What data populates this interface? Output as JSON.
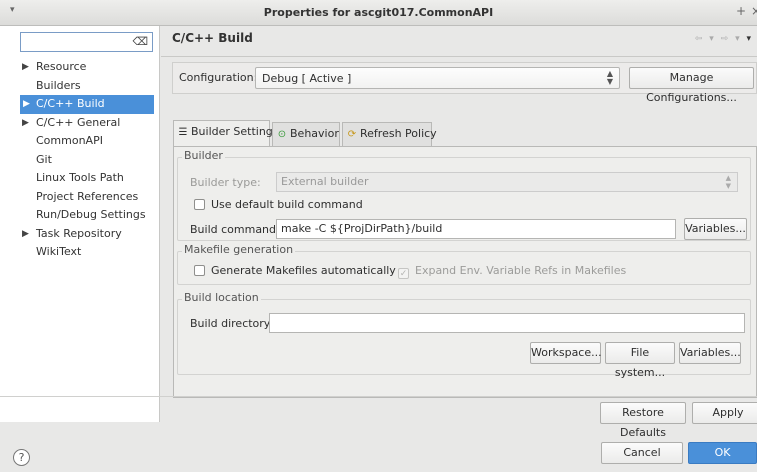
{
  "window": {
    "title": "Properties for ascgit017.CommonAPI",
    "menu_glyph": "▾",
    "btn_add": "+",
    "btn_close": "×"
  },
  "filter": {
    "value": "",
    "clear_glyph": "⌫"
  },
  "nav": {
    "items": [
      {
        "label": "Resource",
        "expandable": true,
        "twisty": "▶"
      },
      {
        "label": "Builders",
        "expandable": false,
        "twisty": ""
      },
      {
        "label": "C/C++ Build",
        "expandable": true,
        "twisty": "▶",
        "selected": true
      },
      {
        "label": "C/C++ General",
        "expandable": true,
        "twisty": "▶"
      },
      {
        "label": "CommonAPI",
        "expandable": false,
        "twisty": ""
      },
      {
        "label": "Git",
        "expandable": false,
        "twisty": ""
      },
      {
        "label": "Linux Tools Path",
        "expandable": false,
        "twisty": ""
      },
      {
        "label": "Project References",
        "expandable": false,
        "twisty": ""
      },
      {
        "label": "Run/Debug Settings",
        "expandable": false,
        "twisty": ""
      },
      {
        "label": "Task Repository",
        "expandable": true,
        "twisty": "▶"
      },
      {
        "label": "WikiText",
        "expandable": false,
        "twisty": ""
      }
    ]
  },
  "page": {
    "title": "C/C++ Build",
    "nav_back": "⇦ ▾",
    "nav_fwd": "⇨ ▾",
    "menu": "▾"
  },
  "configuration": {
    "label": "Configuration:",
    "value": "Debug  [ Active ]",
    "manage_label": "Manage Configurations..."
  },
  "tabs": [
    {
      "label": "Builder Settings",
      "icon": "☰",
      "active": true
    },
    {
      "label": "Behavior",
      "icon": "⊙",
      "active": false
    },
    {
      "label": "Refresh Policy",
      "icon": "⟳",
      "active": false
    }
  ],
  "builder": {
    "group_title": "Builder",
    "type_label": "Builder type:",
    "type_value": "External builder",
    "use_default_label": "Use default build command",
    "command_label": "Build command:",
    "command_value": "make -C ${ProjDirPath}/build",
    "variables_label": "Variables..."
  },
  "makefile": {
    "group_title": "Makefile generation",
    "generate_label": "Generate Makefiles automatically",
    "expand_label": "Expand Env. Variable Refs in Makefiles"
  },
  "location": {
    "group_title": "Build location",
    "dir_label": "Build directory:",
    "dir_value": "",
    "workspace_label": "Workspace...",
    "filesystem_label": "File system...",
    "variables_label": "Variables..."
  },
  "actions": {
    "restore_label": "Restore Defaults",
    "apply_label": "Apply"
  },
  "footer": {
    "help_glyph": "?",
    "cancel_label": "Cancel",
    "ok_label": "OK"
  }
}
